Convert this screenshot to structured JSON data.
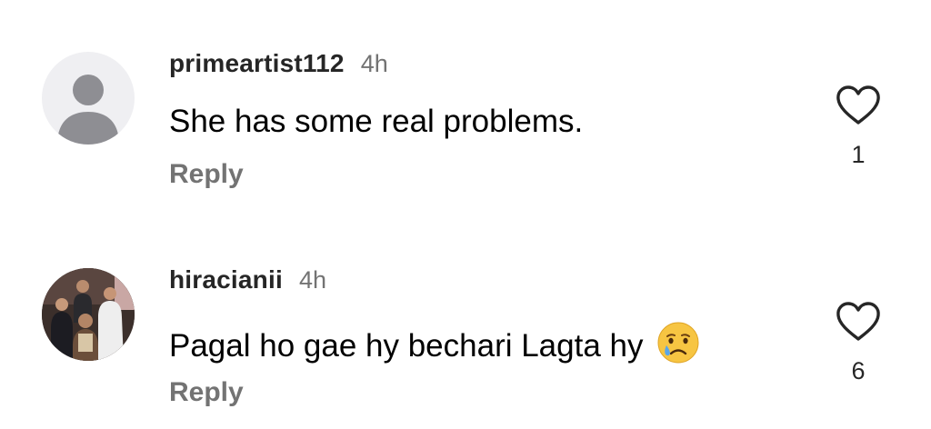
{
  "comments": [
    {
      "username": "primeartist112",
      "time": "4h",
      "text": "She has some real problems.",
      "reply_label": "Reply",
      "likes": "1",
      "avatar": "default-person-icon"
    },
    {
      "username": "hiracianii",
      "time": "4h",
      "text": "Pagal ho gae hy bechari Lagta hy",
      "emoji": "crying-face-emoji",
      "reply_label": "Reply",
      "likes": "6",
      "avatar": "group-photo"
    }
  ],
  "colors": {
    "text": "#000000",
    "secondary": "#737373",
    "username": "#262626",
    "default_avatar_bg": "#efeff2",
    "default_avatar_fg": "#8e8e93"
  }
}
